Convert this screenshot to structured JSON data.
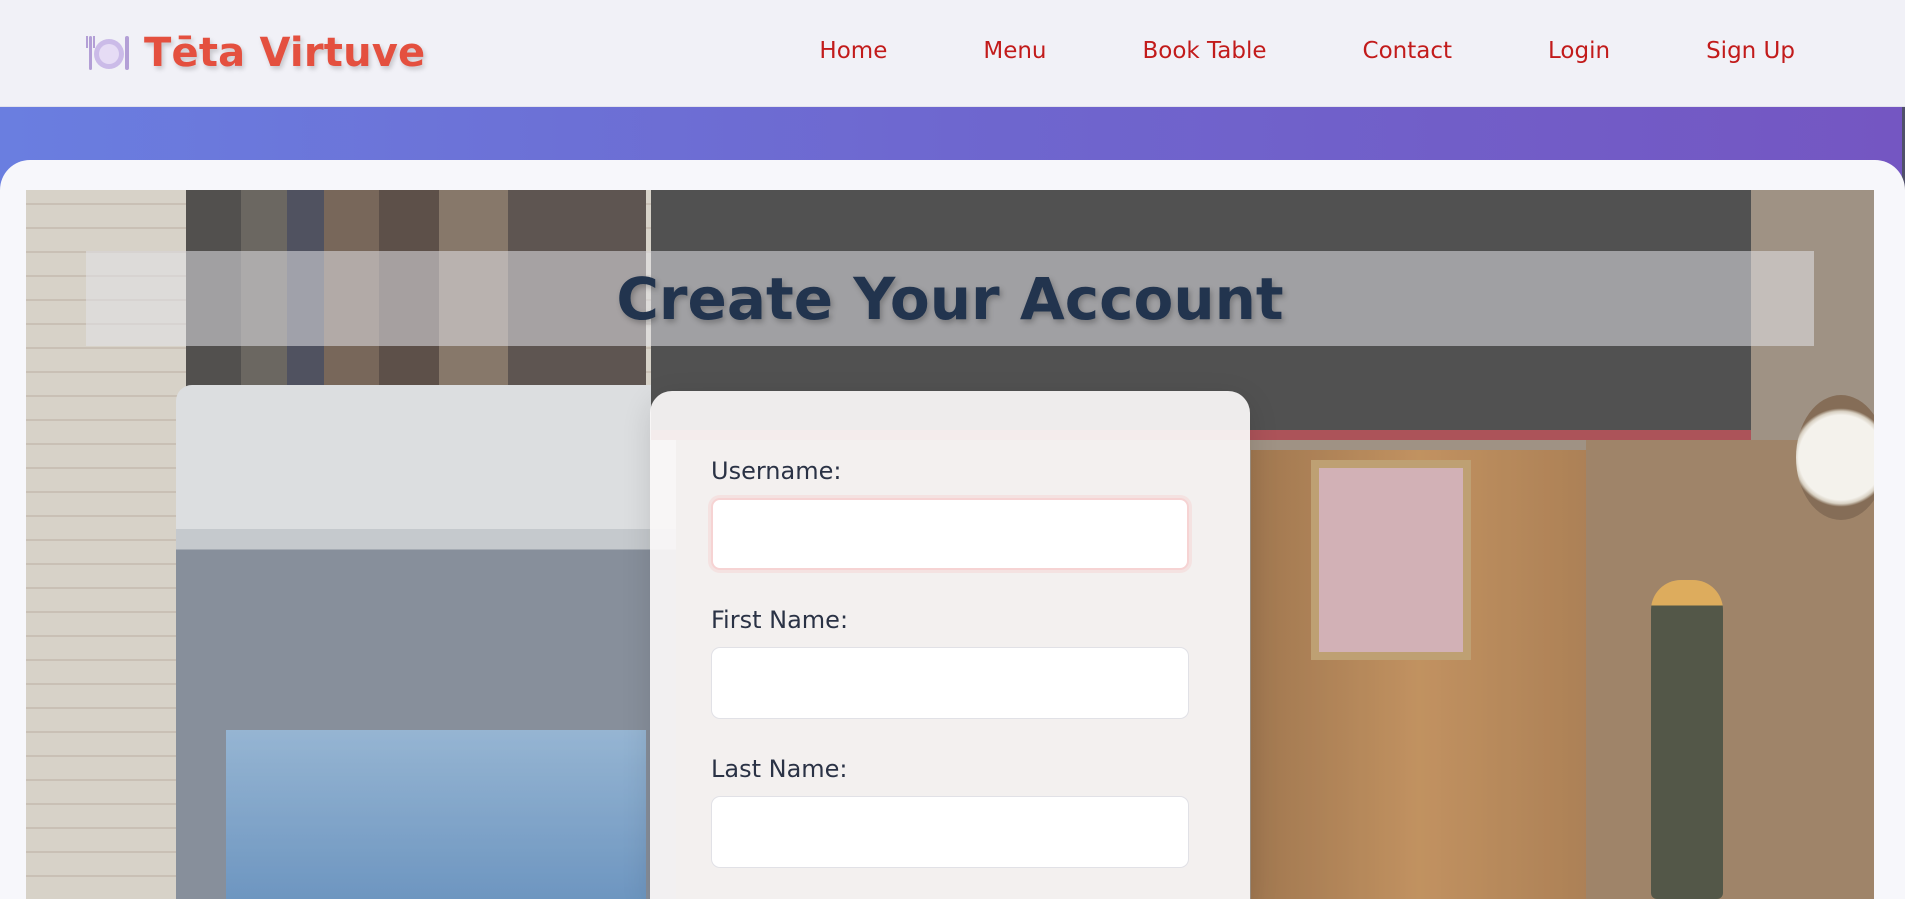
{
  "header": {
    "brand_name": "Tēta Virtuve",
    "brand_icon": "plate-cutlery-icon",
    "nav": [
      {
        "label": "Home"
      },
      {
        "label": "Menu"
      },
      {
        "label": "Book Table"
      },
      {
        "label": "Contact"
      },
      {
        "label": "Login"
      },
      {
        "label": "Sign Up"
      }
    ]
  },
  "main": {
    "title": "Create Your Account",
    "form": {
      "username_label": "Username:",
      "username_value": "",
      "first_name_label": "First Name:",
      "first_name_value": "",
      "last_name_label": "Last Name:",
      "last_name_value": ""
    }
  },
  "colors": {
    "brand": "#e4503f",
    "nav_link": "#c21b1b",
    "title": "#22344e",
    "gradient_start": "#6a7ee0",
    "gradient_end": "#7456c2"
  }
}
